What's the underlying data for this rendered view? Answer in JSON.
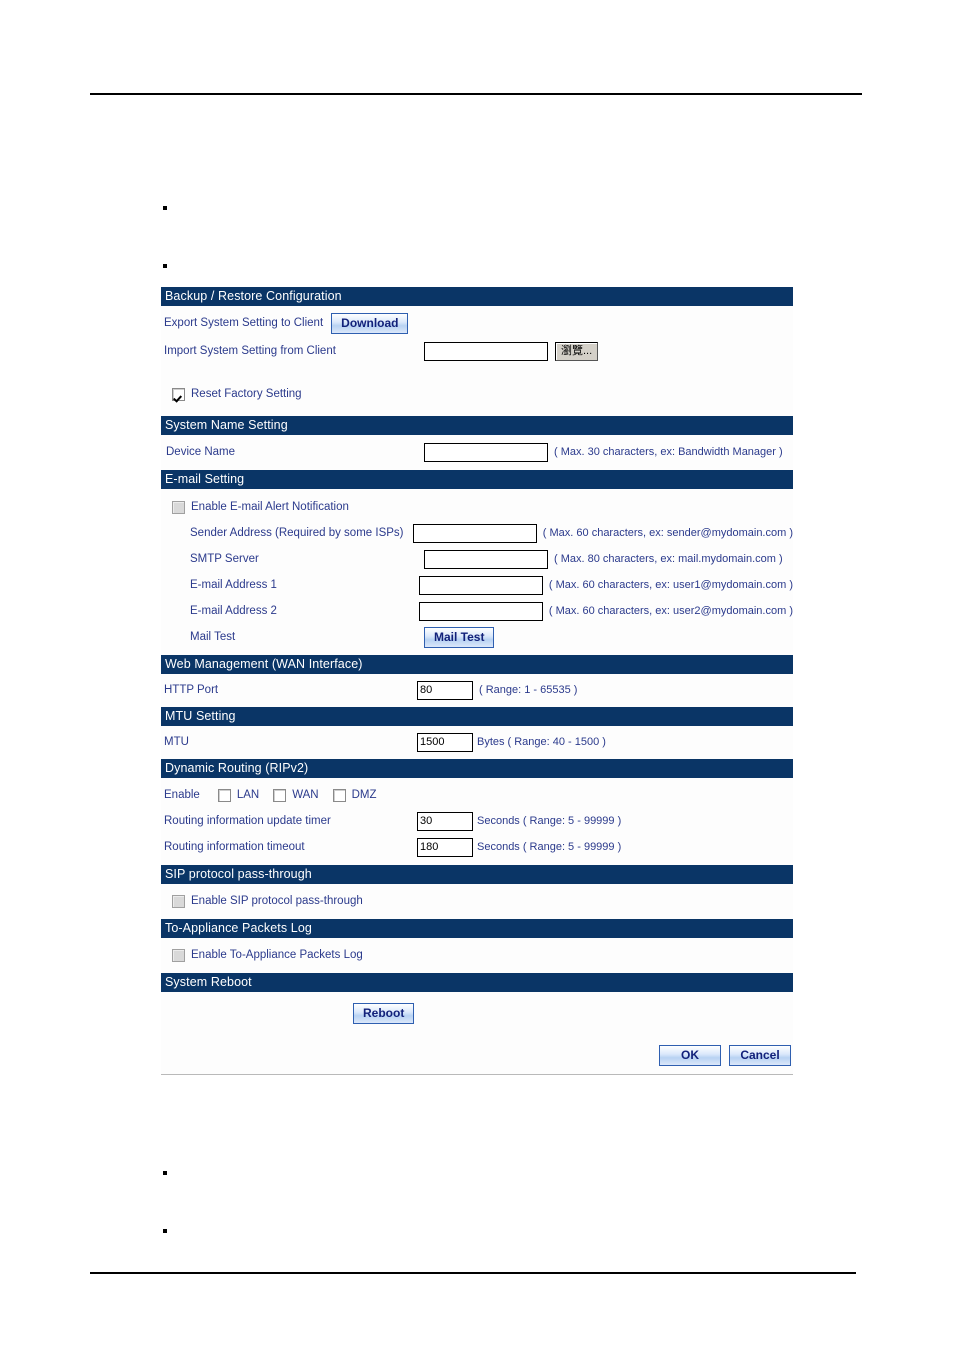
{
  "document": {
    "bullets": [
      "",
      "",
      "",
      ""
    ]
  },
  "panel": {
    "backup_restore": {
      "title": "Backup / Restore Configuration",
      "export_label": "Export System Setting to Client",
      "download_button": "Download",
      "import_label": "Import System Setting from Client",
      "import_value": "",
      "browse_button": "瀏覽...",
      "reset_factory_label": "Reset Factory Setting",
      "reset_factory_checked": true
    },
    "system_name": {
      "title": "System Name Setting",
      "device_name_label": "Device Name",
      "device_name_value": "",
      "device_name_hint": "( Max. 30 characters, ex: Bandwidth Manager )"
    },
    "email": {
      "title": "E-mail Setting",
      "enable_label": "Enable E-mail Alert Notification",
      "enable_checked": false,
      "fields": [
        {
          "label": "Sender Address  (Required by some ISPs)",
          "value": "",
          "hint": "( Max. 60 characters, ex: sender@mydomain.com )"
        },
        {
          "label": "SMTP Server",
          "value": "",
          "hint": "( Max. 80 characters, ex: mail.mydomain.com )"
        },
        {
          "label": "E-mail Address 1",
          "value": "",
          "hint": "( Max. 60 characters, ex: user1@mydomain.com )"
        },
        {
          "label": "E-mail Address 2",
          "value": "",
          "hint": "( Max. 60 characters, ex: user2@mydomain.com )"
        }
      ],
      "mail_test_label": "Mail Test",
      "mail_test_button": "Mail Test"
    },
    "web_management": {
      "title": "Web Management (WAN Interface)",
      "http_port_label": "HTTP Port",
      "http_port_value": "80",
      "http_port_hint": "( Range: 1 - 65535 )"
    },
    "mtu": {
      "title": "MTU Setting",
      "mtu_label": "MTU",
      "mtu_value": "1500",
      "mtu_unit": "Bytes",
      "mtu_hint": "( Range: 40 - 1500 )"
    },
    "dynamic_routing": {
      "title": "Dynamic Routing (RIPv2)",
      "enable_label": "Enable",
      "interfaces": [
        {
          "label": "LAN",
          "checked": false
        },
        {
          "label": "WAN",
          "checked": false
        },
        {
          "label": "DMZ",
          "checked": false
        }
      ],
      "update_timer_label": "Routing information update timer",
      "update_timer_value": "30",
      "update_timer_unit": "Seconds",
      "update_timer_hint": "( Range: 5 - 99999 )",
      "timeout_label": "Routing information timeout",
      "timeout_value": "180",
      "timeout_unit": "Seconds",
      "timeout_hint": "( Range: 5 - 99999 )"
    },
    "sip": {
      "title": "SIP protocol pass-through",
      "enable_label": "Enable SIP protocol pass-through",
      "enable_checked": false
    },
    "packets_log": {
      "title": "To-Appliance Packets Log",
      "enable_label": "Enable To-Appliance Packets Log",
      "enable_checked": false
    },
    "system_reboot": {
      "title": "System Reboot",
      "reboot_button": "Reboot"
    },
    "actions": {
      "ok_button": "OK",
      "cancel_button": "Cancel"
    }
  },
  "colors": {
    "section_bar": "#0a3566",
    "label_text": "#2b3a8c",
    "button_text": "#12217a",
    "button_border": "#2f5fb0"
  }
}
